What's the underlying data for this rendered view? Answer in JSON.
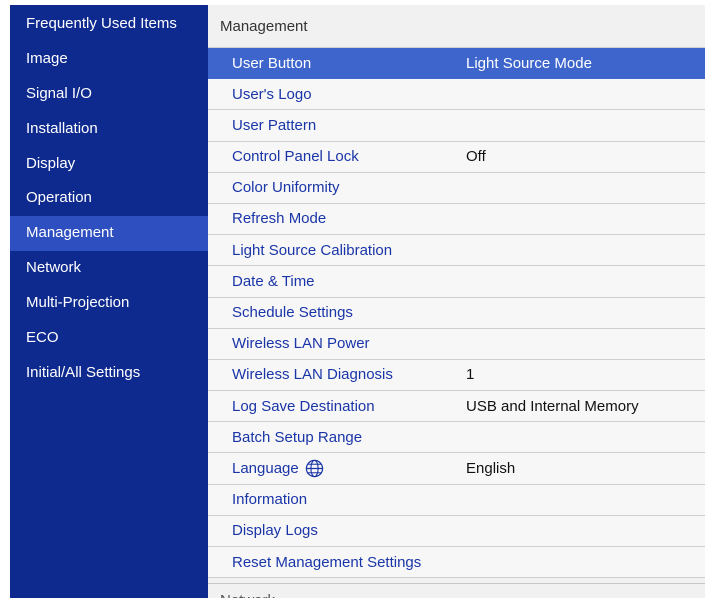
{
  "sidebar": {
    "items": [
      {
        "label": "Frequently Used Items"
      },
      {
        "label": "Image"
      },
      {
        "label": "Signal I/O"
      },
      {
        "label": "Installation"
      },
      {
        "label": "Display"
      },
      {
        "label": "Operation"
      },
      {
        "label": "Management"
      },
      {
        "label": "Network"
      },
      {
        "label": "Multi-Projection"
      },
      {
        "label": "ECO"
      },
      {
        "label": "Initial/All Settings"
      }
    ],
    "active_index": 6
  },
  "main": {
    "title": "Management",
    "rows": [
      {
        "label": "User Button",
        "value": "Light Source Mode"
      },
      {
        "label": "User's Logo",
        "value": ""
      },
      {
        "label": "User Pattern",
        "value": ""
      },
      {
        "label": "Control Panel Lock",
        "value": "Off"
      },
      {
        "label": "Color Uniformity",
        "value": ""
      },
      {
        "label": "Refresh Mode",
        "value": ""
      },
      {
        "label": "Light Source Calibration",
        "value": ""
      },
      {
        "label": "Date & Time",
        "value": ""
      },
      {
        "label": "Schedule Settings",
        "value": ""
      },
      {
        "label": "Wireless LAN Power",
        "value": ""
      },
      {
        "label": "Wireless LAN Diagnosis",
        "value": "1"
      },
      {
        "label": "Log Save Destination",
        "value": "USB and Internal Memory"
      },
      {
        "label": "Batch Setup Range",
        "value": ""
      },
      {
        "label": "Language",
        "value": "English",
        "icon": "globe-icon"
      },
      {
        "label": "Information",
        "value": ""
      },
      {
        "label": "Display Logs",
        "value": ""
      },
      {
        "label": "Reset Management Settings",
        "value": ""
      }
    ],
    "selected_index": 0,
    "next_section": "Network"
  },
  "colors": {
    "sidebar_bg": "#0e2a8f",
    "sidebar_active": "#2d4fbf",
    "row_selected": "#3d65cc",
    "row_label": "#1a35a8"
  }
}
